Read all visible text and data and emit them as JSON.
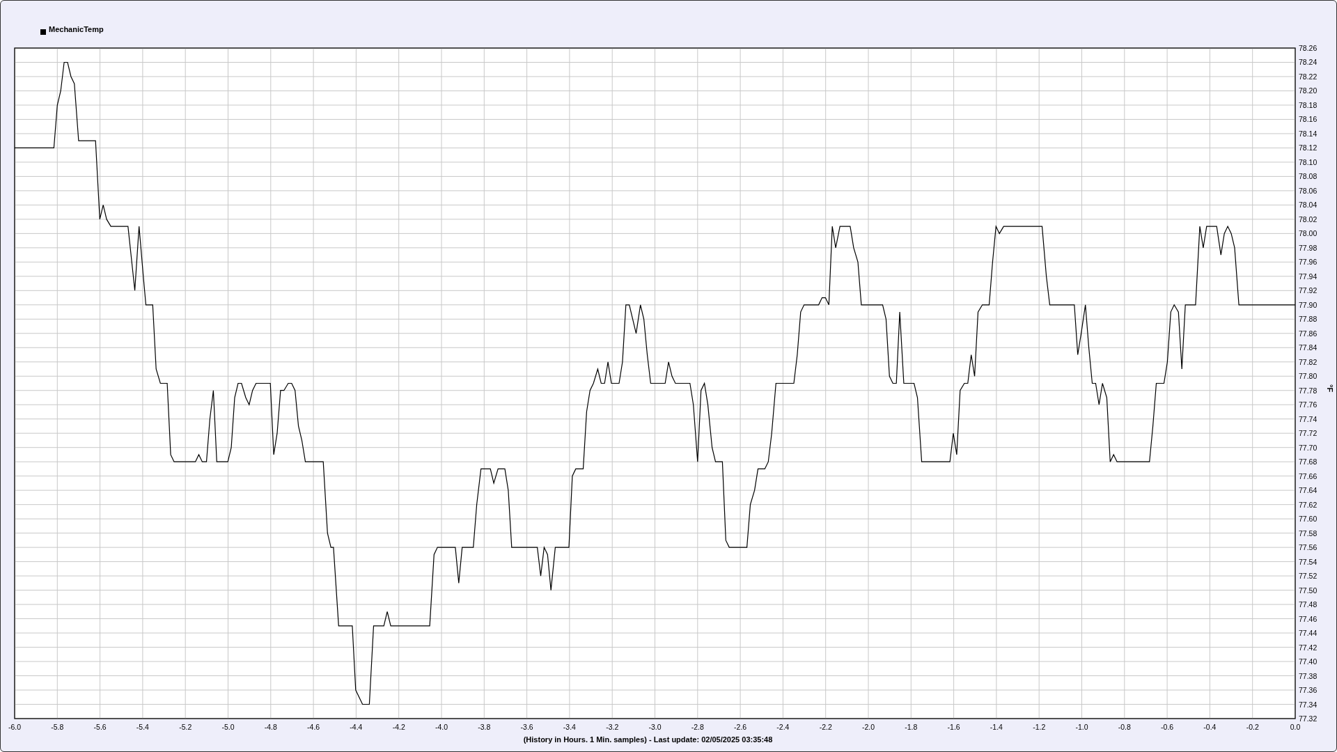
{
  "chart_data": {
    "type": "line",
    "grid": true,
    "xlabel": "(History in Hours. 1 Min. samples) - Last update: 02/05/2025 03:35:48",
    "ylabel": "°F",
    "xlim": [
      -6,
      0
    ],
    "ylim": [
      77.32,
      78.26
    ],
    "x": [
      -6,
      -5.816,
      -5.8,
      -5.784,
      -5.768,
      -5.752,
      -5.736,
      -5.72,
      -5.7,
      -5.621,
      -5.601,
      -5.585,
      -5.569,
      -5.549,
      -5.469,
      -5.437,
      -5.417,
      -5.397,
      -5.385,
      -5.353,
      -5.337,
      -5.317,
      -5.285,
      -5.269,
      -5.253,
      -5.153,
      -5.137,
      -5.121,
      -5.101,
      -5.085,
      -5.069,
      -5.053,
      -5.001,
      -4.985,
      -4.969,
      -4.953,
      -4.937,
      -4.917,
      -4.901,
      -4.885,
      -4.869,
      -4.802,
      -4.786,
      -4.77,
      -4.754,
      -4.738,
      -4.718,
      -4.702,
      -4.686,
      -4.67,
      -4.654,
      -4.638,
      -4.554,
      -4.534,
      -4.518,
      -4.506,
      -4.482,
      -4.418,
      -4.402,
      -4.37,
      -4.338,
      -4.318,
      -4.27,
      -4.254,
      -4.238,
      -4.055,
      -4.035,
      -4.019,
      -3.935,
      -3.919,
      -3.903,
      -3.851,
      -3.835,
      -3.815,
      -3.771,
      -3.755,
      -3.735,
      -3.703,
      -3.687,
      -3.671,
      -3.551,
      -3.535,
      -3.519,
      -3.503,
      -3.487,
      -3.467,
      -3.403,
      -3.387,
      -3.371,
      -3.336,
      -3.32,
      -3.304,
      -3.288,
      -3.268,
      -3.252,
      -3.236,
      -3.22,
      -3.204,
      -3.168,
      -3.152,
      -3.136,
      -3.12,
      -3.104,
      -3.088,
      -3.068,
      -3.052,
      -3.036,
      -3.02,
      -2.952,
      -2.936,
      -2.92,
      -2.904,
      -2.836,
      -2.82,
      -2.8,
      -2.784,
      -2.768,
      -2.752,
      -2.732,
      -2.716,
      -2.684,
      -2.668,
      -2.652,
      -2.569,
      -2.553,
      -2.533,
      -2.517,
      -2.485,
      -2.469,
      -2.453,
      -2.433,
      -2.349,
      -2.333,
      -2.317,
      -2.301,
      -2.233,
      -2.217,
      -2.201,
      -2.185,
      -2.169,
      -2.153,
      -2.133,
      -2.085,
      -2.069,
      -2.049,
      -2.033,
      -1.933,
      -1.917,
      -1.901,
      -1.885,
      -1.869,
      -1.853,
      -1.834,
      -1.786,
      -1.77,
      -1.75,
      -1.618,
      -1.602,
      -1.586,
      -1.57,
      -1.55,
      -1.534,
      -1.518,
      -1.502,
      -1.486,
      -1.466,
      -1.434,
      -1.418,
      -1.402,
      -1.386,
      -1.366,
      -1.186,
      -1.166,
      -1.15,
      -1.035,
      -1.019,
      -1.003,
      -0.983,
      -0.967,
      -0.951,
      -0.935,
      -0.919,
      -0.903,
      -0.883,
      -0.867,
      -0.851,
      -0.835,
      -0.683,
      -0.667,
      -0.651,
      -0.615,
      -0.599,
      -0.583,
      -0.567,
      -0.547,
      -0.531,
      -0.515,
      -0.467,
      -0.447,
      -0.431,
      -0.415,
      -0.368,
      -0.348,
      -0.332,
      -0.316,
      -0.3,
      -0.284,
      -0.264,
      0
    ],
    "series": [
      {
        "name": "MechanicTemp",
        "color": "#000000",
        "values": [
          78.12,
          78.12,
          78.18,
          78.2,
          78.24,
          78.24,
          78.22,
          78.21,
          78.13,
          78.13,
          78.02,
          78.04,
          78.02,
          78.01,
          78.01,
          77.92,
          78.01,
          77.94,
          77.9,
          77.9,
          77.81,
          77.79,
          77.79,
          77.69,
          77.68,
          77.68,
          77.69,
          77.68,
          77.68,
          77.74,
          77.78,
          77.68,
          77.68,
          77.7,
          77.77,
          77.79,
          77.79,
          77.77,
          77.76,
          77.78,
          77.79,
          77.79,
          77.69,
          77.72,
          77.78,
          77.78,
          77.79,
          77.79,
          77.78,
          77.73,
          77.71,
          77.68,
          77.68,
          77.58,
          77.56,
          77.56,
          77.45,
          77.45,
          77.36,
          77.34,
          77.34,
          77.45,
          77.45,
          77.47,
          77.45,
          77.45,
          77.55,
          77.56,
          77.56,
          77.51,
          77.56,
          77.56,
          77.62,
          77.67,
          77.67,
          77.65,
          77.67,
          77.67,
          77.64,
          77.56,
          77.56,
          77.52,
          77.56,
          77.55,
          77.5,
          77.56,
          77.56,
          77.66,
          77.67,
          77.67,
          77.75,
          77.78,
          77.79,
          77.81,
          77.79,
          77.79,
          77.82,
          77.79,
          77.79,
          77.82,
          77.9,
          77.9,
          77.88,
          77.86,
          77.9,
          77.88,
          77.83,
          77.79,
          77.79,
          77.82,
          77.8,
          77.79,
          77.79,
          77.76,
          77.68,
          77.78,
          77.79,
          77.76,
          77.7,
          77.68,
          77.68,
          77.57,
          77.56,
          77.56,
          77.62,
          77.64,
          77.67,
          77.67,
          77.68,
          77.72,
          77.79,
          77.79,
          77.83,
          77.89,
          77.9,
          77.9,
          77.91,
          77.91,
          77.9,
          78.01,
          77.98,
          78.01,
          78.01,
          77.98,
          77.96,
          77.9,
          77.9,
          77.88,
          77.8,
          77.79,
          77.79,
          77.89,
          77.79,
          77.79,
          77.77,
          77.68,
          77.68,
          77.72,
          77.69,
          77.78,
          77.79,
          77.79,
          77.83,
          77.8,
          77.89,
          77.9,
          77.9,
          77.96,
          78.01,
          78,
          78.01,
          78.01,
          77.94,
          77.9,
          77.9,
          77.83,
          77.86,
          77.9,
          77.84,
          77.79,
          77.79,
          77.76,
          77.79,
          77.77,
          77.68,
          77.69,
          77.68,
          77.68,
          77.73,
          77.79,
          77.79,
          77.82,
          77.89,
          77.9,
          77.89,
          77.81,
          77.9,
          77.9,
          78.01,
          77.98,
          78.01,
          78.01,
          77.97,
          78,
          78.01,
          78,
          77.98,
          77.9,
          77.9
        ]
      }
    ],
    "xticks": [
      {
        "value": -6,
        "label": "-6.0"
      },
      {
        "value": -5.8,
        "label": "-5.8"
      },
      {
        "value": -5.6,
        "label": "-5.6"
      },
      {
        "value": -5.4,
        "label": "-5.4"
      },
      {
        "value": -5.2,
        "label": "-5.2"
      },
      {
        "value": -5,
        "label": "-5.0"
      },
      {
        "value": -4.8,
        "label": "-4.8"
      },
      {
        "value": -4.6,
        "label": "-4.6"
      },
      {
        "value": -4.4,
        "label": "-4.4"
      },
      {
        "value": -4.2,
        "label": "-4.2"
      },
      {
        "value": -4,
        "label": "-4.0"
      },
      {
        "value": -3.8,
        "label": "-3.8"
      },
      {
        "value": -3.6,
        "label": "-3.6"
      },
      {
        "value": -3.4,
        "label": "-3.4"
      },
      {
        "value": -3.2,
        "label": "-3.2"
      },
      {
        "value": -3,
        "label": "-3.0"
      },
      {
        "value": -2.8,
        "label": "-2.8"
      },
      {
        "value": -2.6,
        "label": "-2.6"
      },
      {
        "value": -2.4,
        "label": "-2.4"
      },
      {
        "value": -2.2,
        "label": "-2.2"
      },
      {
        "value": -2,
        "label": "-2.0"
      },
      {
        "value": -1.8,
        "label": "-1.8"
      },
      {
        "value": -1.6,
        "label": "-1.6"
      },
      {
        "value": -1.4,
        "label": "-1.4"
      },
      {
        "value": -1.2,
        "label": "-1.2"
      },
      {
        "value": -1,
        "label": "-1.0"
      },
      {
        "value": -0.8,
        "label": "-0.8"
      },
      {
        "value": -0.6,
        "label": "-0.6"
      },
      {
        "value": -0.4,
        "label": "-0.4"
      },
      {
        "value": -0.2,
        "label": "-0.2"
      },
      {
        "value": 0,
        "label": "0.0"
      }
    ],
    "yticks": [
      {
        "value": 77.32,
        "label": "77.32"
      },
      {
        "value": 77.34,
        "label": "77.34"
      },
      {
        "value": 77.36,
        "label": "77.36"
      },
      {
        "value": 77.38,
        "label": "77.38"
      },
      {
        "value": 77.4,
        "label": "77.40"
      },
      {
        "value": 77.42,
        "label": "77.42"
      },
      {
        "value": 77.44,
        "label": "77.44"
      },
      {
        "value": 77.46,
        "label": "77.46"
      },
      {
        "value": 77.48,
        "label": "77.48"
      },
      {
        "value": 77.5,
        "label": "77.50"
      },
      {
        "value": 77.52,
        "label": "77.52"
      },
      {
        "value": 77.54,
        "label": "77.54"
      },
      {
        "value": 77.56,
        "label": "77.56"
      },
      {
        "value": 77.58,
        "label": "77.58"
      },
      {
        "value": 77.6,
        "label": "77.60"
      },
      {
        "value": 77.62,
        "label": "77.62"
      },
      {
        "value": 77.64,
        "label": "77.64"
      },
      {
        "value": 77.66,
        "label": "77.66"
      },
      {
        "value": 77.68,
        "label": "77.68"
      },
      {
        "value": 77.7,
        "label": "77.70"
      },
      {
        "value": 77.72,
        "label": "77.72"
      },
      {
        "value": 77.74,
        "label": "77.74"
      },
      {
        "value": 77.76,
        "label": "77.76"
      },
      {
        "value": 77.78,
        "label": "77.78"
      },
      {
        "value": 77.8,
        "label": "77.80"
      },
      {
        "value": 77.82,
        "label": "77.82"
      },
      {
        "value": 77.84,
        "label": "77.84"
      },
      {
        "value": 77.86,
        "label": "77.86"
      },
      {
        "value": 77.88,
        "label": "77.88"
      },
      {
        "value": 77.9,
        "label": "77.90"
      },
      {
        "value": 77.92,
        "label": "77.92"
      },
      {
        "value": 77.94,
        "label": "77.94"
      },
      {
        "value": 77.96,
        "label": "77.96"
      },
      {
        "value": 77.98,
        "label": "77.98"
      },
      {
        "value": 78,
        "label": "78.00"
      },
      {
        "value": 78.02,
        "label": "78.02"
      },
      {
        "value": 78.04,
        "label": "78.04"
      },
      {
        "value": 78.06,
        "label": "78.06"
      },
      {
        "value": 78.08,
        "label": "78.08"
      },
      {
        "value": 78.1,
        "label": "78.10"
      },
      {
        "value": 78.12,
        "label": "78.12"
      },
      {
        "value": 78.14,
        "label": "78.14"
      },
      {
        "value": 78.16,
        "label": "78.16"
      },
      {
        "value": 78.18,
        "label": "78.18"
      },
      {
        "value": 78.2,
        "label": "78.20"
      },
      {
        "value": 78.22,
        "label": "78.22"
      },
      {
        "value": 78.24,
        "label": "78.24"
      },
      {
        "value": 78.26,
        "label": "78.26"
      }
    ]
  }
}
